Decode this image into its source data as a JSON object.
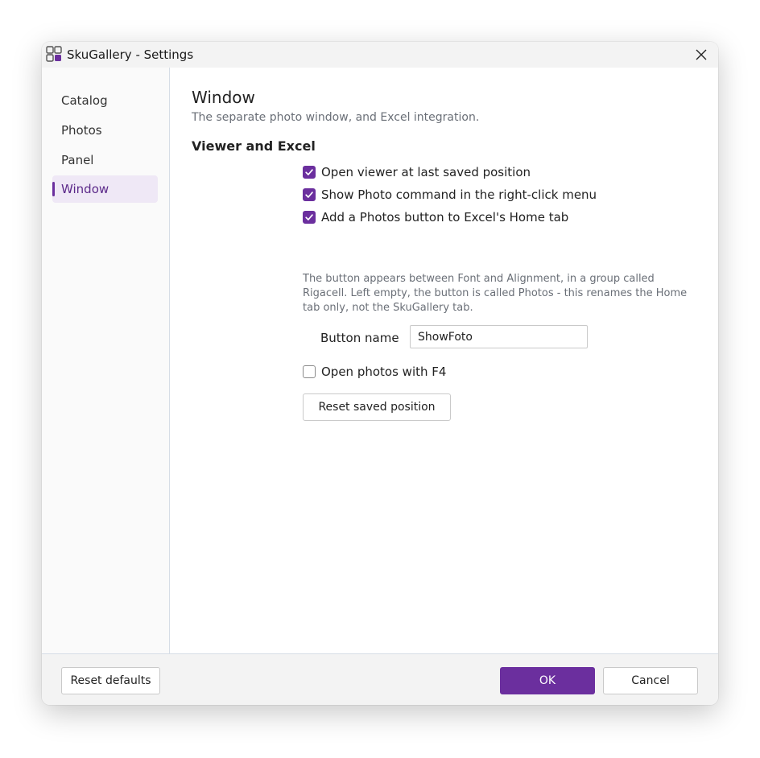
{
  "window": {
    "app_name": "SkuGallery",
    "title": "SkuGallery - Settings",
    "accent_color": "#6b2f9e"
  },
  "sidebar": {
    "items": [
      {
        "label": "Catalog",
        "active": false
      },
      {
        "label": "Photos",
        "active": false
      },
      {
        "label": "Panel",
        "active": false
      },
      {
        "label": "Window",
        "active": true
      }
    ]
  },
  "page": {
    "title": "Window",
    "subtitle": "The separate photo window, and Excel integration.",
    "section_title": "Viewer and Excel"
  },
  "options": [
    {
      "label": "Open viewer at last saved position",
      "checked": true
    },
    {
      "label": "Show Photo command in the right-click menu",
      "checked": true
    },
    {
      "label": "Add a Photos button to Excel's Home tab",
      "checked": true
    }
  ],
  "help_text": "The button appears between Font and Alignment, in a group called Rigacell. Left empty, the button is called Photos - this renames the Home tab only, not the SkuGallery tab.",
  "button_name": {
    "label": "Button name",
    "value": "ShowFoto"
  },
  "f4_option": {
    "label": "Open photos with F4",
    "checked": false
  },
  "reset_position_label": "Reset saved position",
  "footer": {
    "reset_defaults_label": "Reset defaults",
    "ok_label": "OK",
    "cancel_label": "Cancel"
  }
}
